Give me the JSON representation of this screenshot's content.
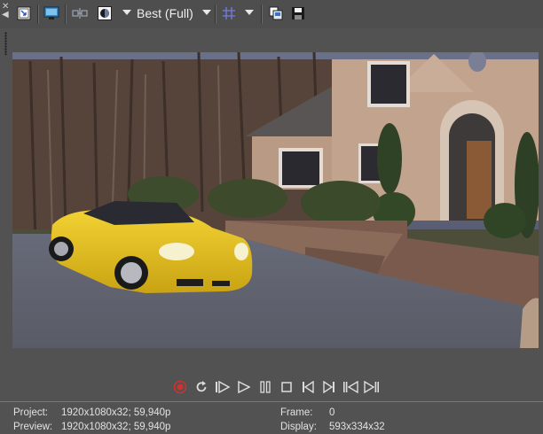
{
  "toolbar": {
    "quality": "Best (Full)",
    "icons": [
      "close-icon",
      "collapse-arrow-icon",
      "video-fx-icon",
      "external-monitor-icon",
      "split-screen-icon",
      "overlay-icon",
      "quality-dropdown",
      "grid-overlay-icon",
      "copy-snapshot-icon",
      "save-snapshot-icon"
    ]
  },
  "transport": {
    "icons": [
      "record-icon",
      "loop-icon",
      "play-from-start-icon",
      "play-icon",
      "pause-icon",
      "stop-icon",
      "previous-frame-icon",
      "next-frame-icon",
      "go-to-start-icon",
      "go-to-end-icon"
    ]
  },
  "status": {
    "project_label": "Project:",
    "project_value": "1920x1080x32; 59,940p",
    "preview_label": "Preview:",
    "preview_value": "1920x1080x32; 59,940p",
    "frame_label": "Frame:",
    "frame_value": "0",
    "display_label": "Display:",
    "display_value": "593x334x32"
  },
  "colors": {
    "background": "#525252",
    "record": "#d0312d",
    "icon": "#dcdcdc"
  }
}
